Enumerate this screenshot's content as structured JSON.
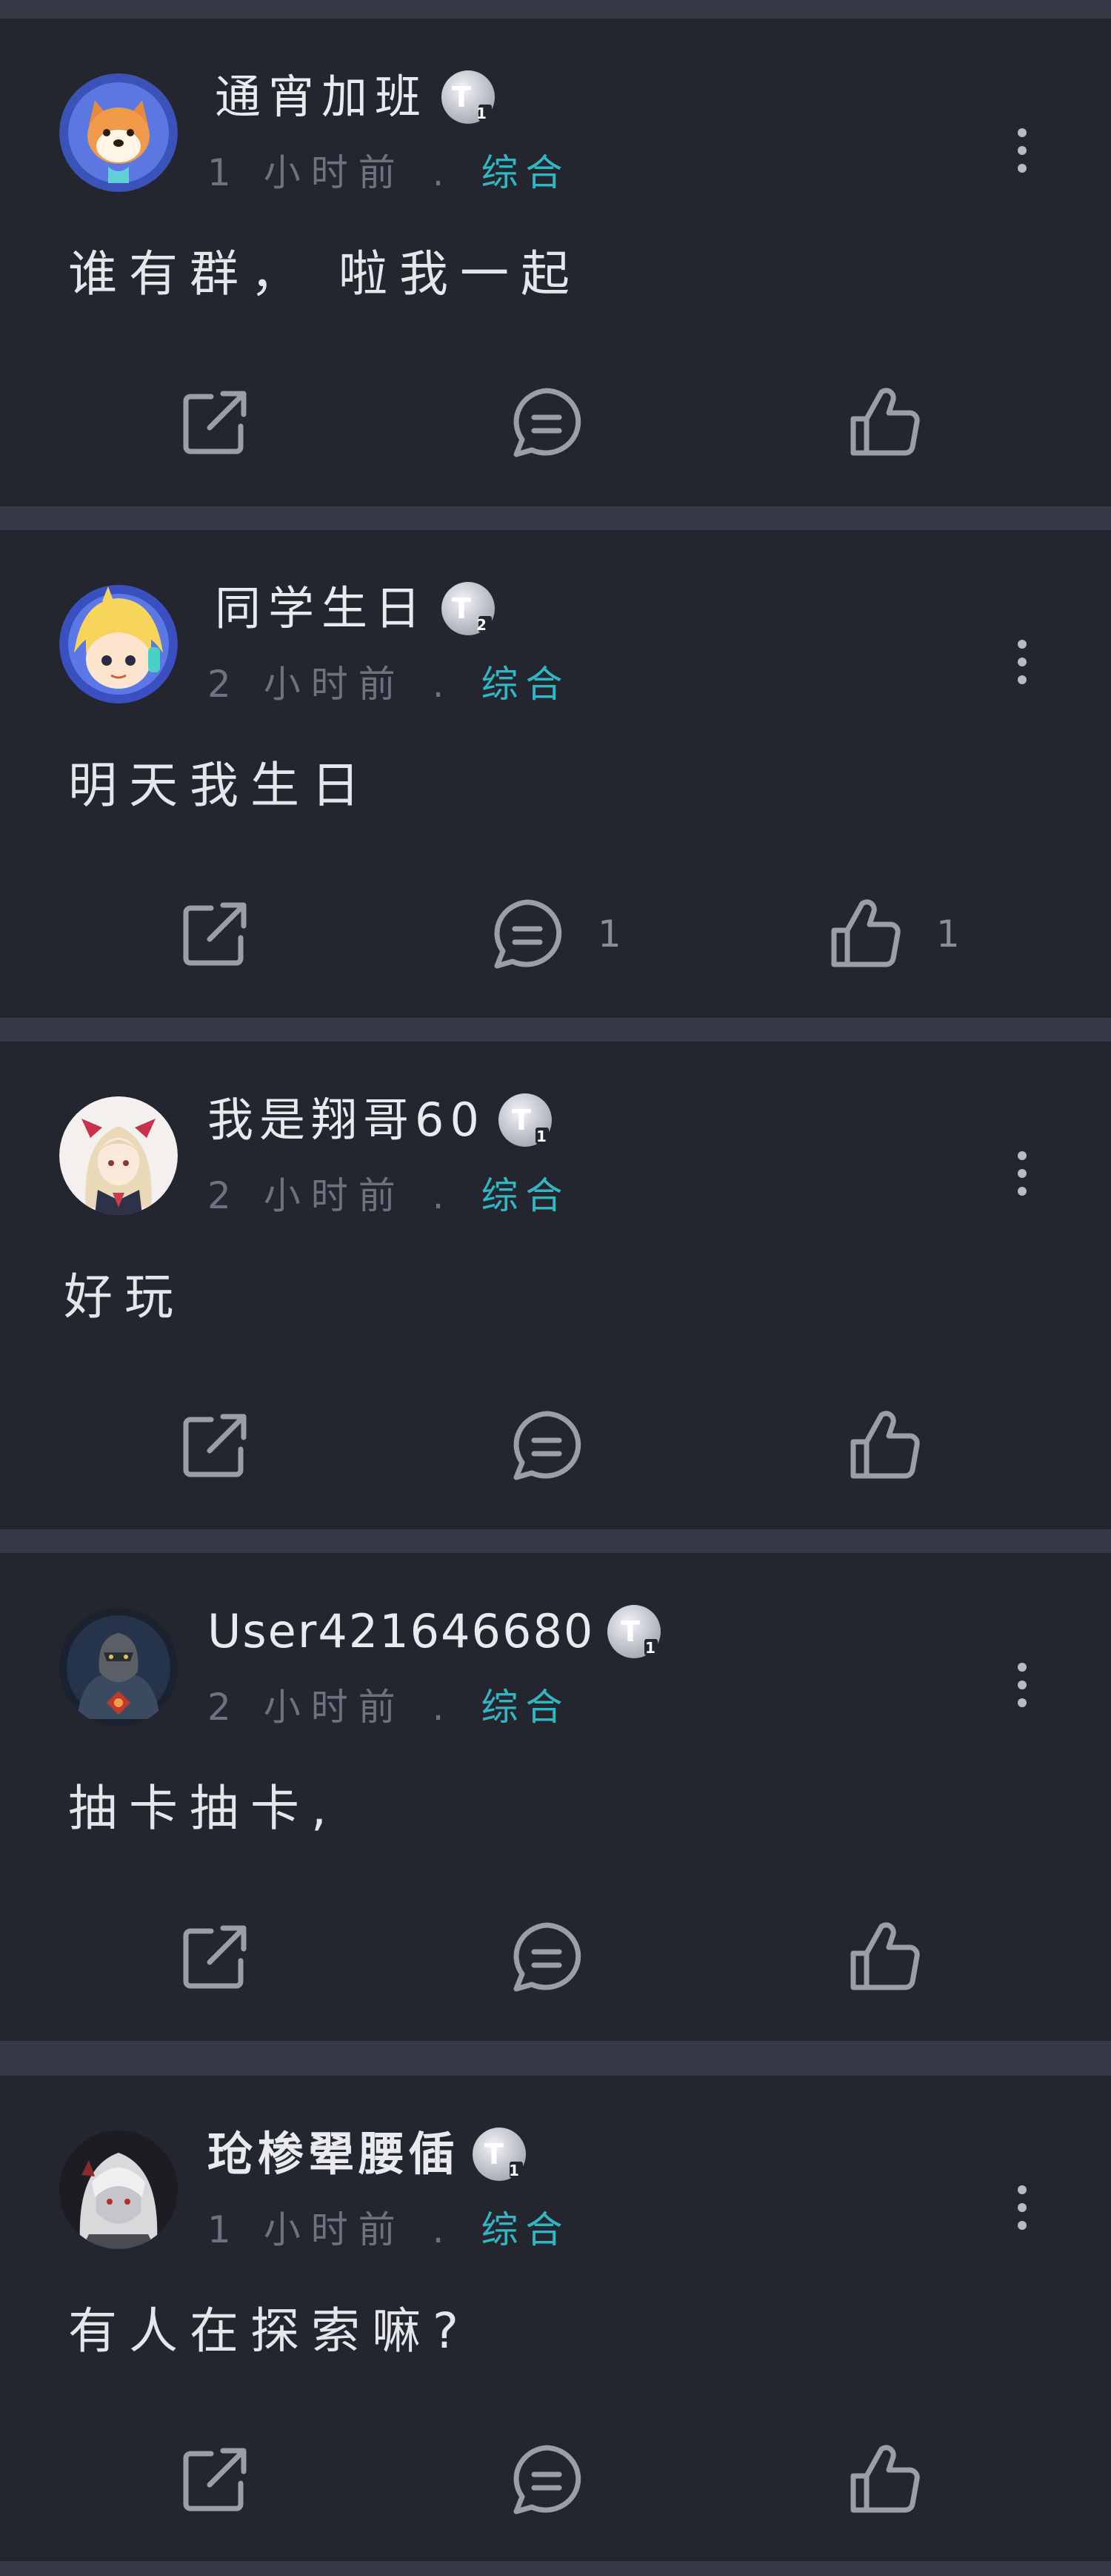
{
  "colors": {
    "background": "#343945",
    "card": "#23252f",
    "text": "#e9eaee",
    "muted": "#6e7280",
    "accent": "#31b7c4",
    "icon": "#9a9ea8"
  },
  "posts": [
    {
      "username": "通宵加班",
      "level_badge": "T1",
      "time": "1 小时前",
      "separator": ".",
      "category": "综合",
      "content": "谁有群， 啦我一起",
      "avatar_icon": "shiba-dog-avatar",
      "share_icon": "share-icon",
      "comment_icon": "comment-icon",
      "comment_count": "",
      "like_icon": "thumbs-up-icon",
      "like_count": ""
    },
    {
      "username": "同学生日",
      "level_badge": "T2",
      "time": "2 小时前",
      "separator": ".",
      "category": "综合",
      "content": "明天我生日",
      "avatar_icon": "blonde-girl-avatar",
      "share_icon": "share-icon",
      "comment_icon": "comment-icon",
      "comment_count": "1",
      "like_icon": "thumbs-up-icon",
      "like_count": "1"
    },
    {
      "username": "我是翔哥60",
      "level_badge": "T1",
      "time": "2 小时前",
      "separator": ".",
      "category": "综合",
      "content": "好玩",
      "avatar_icon": "anime-girl-avatar",
      "share_icon": "share-icon",
      "comment_icon": "comment-icon",
      "comment_count": "",
      "like_icon": "thumbs-up-icon",
      "like_count": ""
    },
    {
      "username": "User421646680",
      "level_badge": "T1",
      "time": "2 小时前",
      "separator": ".",
      "category": "综合",
      "content": "抽卡抽卡,",
      "avatar_icon": "armored-warrior-avatar",
      "share_icon": "share-icon",
      "comment_icon": "comment-icon",
      "comment_count": "",
      "like_icon": "thumbs-up-icon",
      "like_count": ""
    },
    {
      "username": "玱椮翚腰偛",
      "level_badge": "T1",
      "time": "1 小时前",
      "separator": ".",
      "category": "综合",
      "content": "有人在探索嘛?",
      "avatar_icon": "white-hair-character-avatar",
      "share_icon": "share-icon",
      "comment_icon": "comment-icon",
      "comment_count": "",
      "like_icon": "thumbs-up-icon",
      "like_count": ""
    }
  ]
}
